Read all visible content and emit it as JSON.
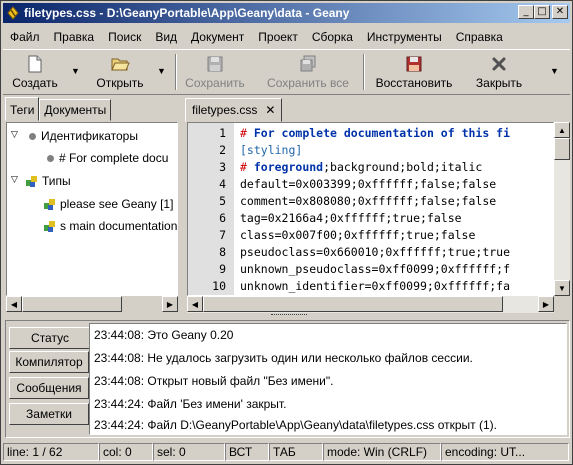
{
  "window": {
    "title": "filetypes.css - D:\\GeanyPortable\\App\\Geany\\data - Geany",
    "controls": {
      "minimize": "_",
      "maximize": "□",
      "close": "✕"
    }
  },
  "menu": {
    "file": "Файл",
    "edit": "Правка",
    "search": "Поиск",
    "view": "Вид",
    "document": "Документ",
    "project": "Проект",
    "build": "Сборка",
    "tools": "Инструменты",
    "help": "Справка"
  },
  "toolbar": {
    "new": "Создать",
    "open": "Открыть",
    "save": "Сохранить",
    "save_all": "Сохранить все",
    "revert": "Восстановить",
    "close": "Закрыть",
    "dropdown_glyph": "▼"
  },
  "sidebar": {
    "tabs": [
      "Теги",
      "Документы"
    ],
    "tree": {
      "group1": {
        "expander": "▽",
        "label": "Идентификаторы"
      },
      "group1_child": "# For complete docu",
      "group2": {
        "expander": "▽",
        "label": "Типы"
      },
      "group2_children": [
        "please see Geany [1]",
        "s main documentation"
      ]
    }
  },
  "editor": {
    "tab_label": "filetypes.css",
    "tab_close": "✕",
    "line_numbers": [
      "1",
      "2",
      "3",
      "4",
      "5",
      "6",
      "7",
      "8",
      "9",
      "10"
    ],
    "lines": [
      {
        "hash": "# ",
        "text": "For complete documentation of this fi"
      },
      {
        "text": "[styling]"
      },
      {
        "hash": "# ",
        "text": "foreground",
        "rest": ";background;bold;italic"
      },
      {
        "text": "default=0x003399;0xffffff;false;false"
      },
      {
        "text": "comment=0x808080;0xffffff;false;false"
      },
      {
        "text": "tag=0x2166a4;0xffffff;true;false"
      },
      {
        "text": "class=0x007f00;0xffffff;true;false"
      },
      {
        "text": "pseudoclass=0x660010;0xffffff;true;true"
      },
      {
        "text": "unknown_pseudoclass=0xff0099;0xffffff;f"
      },
      {
        "text": "unknown_identifier=0xff0099;0xffffff;fa"
      }
    ]
  },
  "messages": {
    "tabs": [
      "Статус",
      "Компилятор",
      "Сообщения",
      "Заметки"
    ],
    "lines": [
      "23:44:08: Это Geany 0.20",
      "23:44:08: Не удалось загрузить один или несколько файлов сессии.",
      "23:44:08: Открыт новый файл \"Без имени\".",
      "23:44:24: Файл 'Без имени' закрыт.",
      "23:44:24: Файл D:\\GeanyPortable\\App\\Geany\\data\\filetypes.css открыт (1)."
    ]
  },
  "statusbar": {
    "line": "line: 1 / 62",
    "col": "col: 0",
    "sel": "sel: 0",
    "ins": "ВСТ",
    "tab": "ТАБ",
    "mode": "mode: Win (CRLF)",
    "encoding": "encoding: UT..."
  },
  "colors": {
    "title_start": "#0a246a",
    "title_end": "#a6caf0",
    "comment": "#0033aa",
    "hash": "#d00000",
    "section": "#2266aa"
  }
}
